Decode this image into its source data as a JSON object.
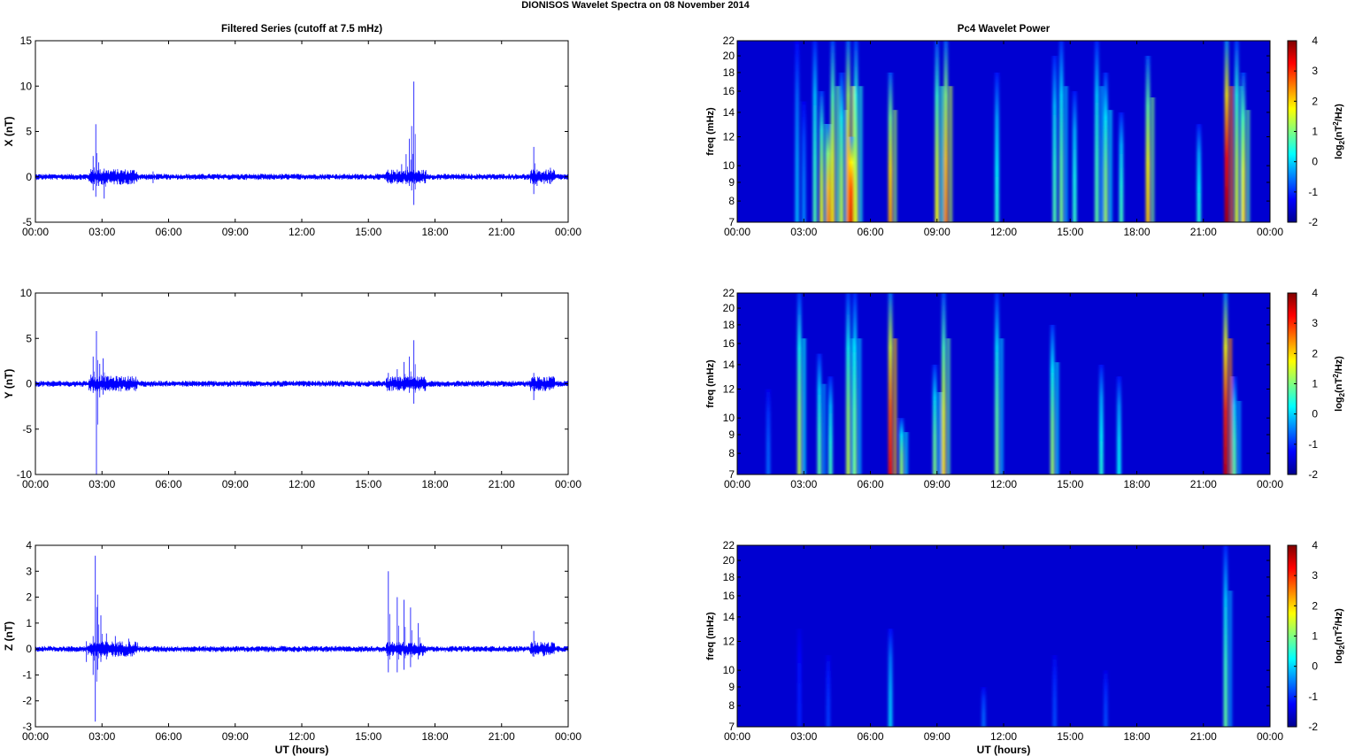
{
  "figure": {
    "title": "DIONISOS Wavelet Spectra on 08 November  2014"
  },
  "colors": {
    "trace": "#0000ff",
    "axis": "#000000"
  },
  "colormap": "jet",
  "chart_data": [
    {
      "type": "line",
      "panel": "X",
      "title": "Filtered Series (cutoff at 7.5 mHz)",
      "xlabel": "",
      "ylabel": "X (nT)",
      "xlim": [
        0,
        24
      ],
      "ylim": [
        -5,
        15
      ],
      "xticks": [
        "00:00",
        "03:00",
        "06:00",
        "09:00",
        "12:00",
        "15:00",
        "18:00",
        "21:00",
        "00:00"
      ],
      "yticks": [
        -5,
        0,
        5,
        10,
        15
      ],
      "series": [
        {
          "x_hours": [
            0,
            24
          ],
          "baseline": 0
        }
      ],
      "bursts": [
        {
          "t": 2.6,
          "max": 2.3,
          "min": -1.5
        },
        {
          "t": 2.72,
          "max": 5.8,
          "min": -2.2
        },
        {
          "t": 2.85,
          "max": 1.6,
          "min": -1.0
        },
        {
          "t": 3.1,
          "max": 0.9,
          "min": -2.4
        },
        {
          "t": 3.4,
          "max": 0.6,
          "min": -0.6
        },
        {
          "t": 5.3,
          "max": 0.6,
          "min": -0.7
        },
        {
          "t": 16.3,
          "max": 0.8,
          "min": -0.5
        },
        {
          "t": 16.5,
          "max": 1.4,
          "min": -0.6
        },
        {
          "t": 16.7,
          "max": 2.5,
          "min": -0.8
        },
        {
          "t": 16.85,
          "max": 4.2,
          "min": -1.0
        },
        {
          "t": 16.95,
          "max": 5.6,
          "min": -1.5
        },
        {
          "t": 17.05,
          "max": 10.5,
          "min": -3.1
        },
        {
          "t": 22.45,
          "max": 3.3,
          "min": -1.9
        },
        {
          "t": 22.6,
          "max": 0.8,
          "min": -1.0
        },
        {
          "t": 23.2,
          "max": 1.0,
          "min": -0.8
        }
      ]
    },
    {
      "type": "line",
      "panel": "Y",
      "title": "",
      "xlabel": "",
      "ylabel": "Y (nT)",
      "xlim": [
        0,
        24
      ],
      "ylim": [
        -10,
        10
      ],
      "xticks": [
        "00:00",
        "03:00",
        "06:00",
        "09:00",
        "12:00",
        "15:00",
        "18:00",
        "21:00",
        "00:00"
      ],
      "yticks": [
        -10,
        -5,
        0,
        5,
        10
      ],
      "series": [
        {
          "x_hours": [
            0,
            24
          ],
          "baseline": 0
        }
      ],
      "bursts": [
        {
          "t": 2.5,
          "max": 1.0,
          "min": -0.6
        },
        {
          "t": 2.6,
          "max": 3.0,
          "min": -1.0
        },
        {
          "t": 2.75,
          "max": 5.8,
          "min": -10.0
        },
        {
          "t": 2.9,
          "max": 2.2,
          "min": -1.5
        },
        {
          "t": 3.05,
          "max": 2.8,
          "min": -1.2
        },
        {
          "t": 3.3,
          "max": 0.8,
          "min": -0.6
        },
        {
          "t": 15.9,
          "max": 1.2,
          "min": -0.4
        },
        {
          "t": 16.3,
          "max": 1.6,
          "min": -0.6
        },
        {
          "t": 16.6,
          "max": 2.4,
          "min": -0.8
        },
        {
          "t": 16.85,
          "max": 3.0,
          "min": -1.0
        },
        {
          "t": 17.05,
          "max": 4.8,
          "min": -2.2
        },
        {
          "t": 22.45,
          "max": 1.2,
          "min": -1.8
        }
      ]
    },
    {
      "type": "line",
      "panel": "Z",
      "title": "",
      "xlabel": "UT (hours)",
      "ylabel": "Z (nT)",
      "xlim": [
        0,
        24
      ],
      "ylim": [
        -3,
        4
      ],
      "xticks": [
        "00:00",
        "03:00",
        "06:00",
        "09:00",
        "12:00",
        "15:00",
        "18:00",
        "21:00",
        "00:00"
      ],
      "yticks": [
        -3,
        -2,
        -1,
        0,
        1,
        2,
        3,
        4
      ],
      "series": [
        {
          "x_hours": [
            0,
            24
          ],
          "baseline": 0
        }
      ],
      "bursts": [
        {
          "t": 2.3,
          "max": 0.3,
          "min": -0.5
        },
        {
          "t": 2.6,
          "max": 0.5,
          "min": -1.0
        },
        {
          "t": 2.7,
          "max": 3.6,
          "min": -2.8
        },
        {
          "t": 2.8,
          "max": 2.1,
          "min": -0.8
        },
        {
          "t": 2.95,
          "max": 1.3,
          "min": -0.5
        },
        {
          "t": 3.2,
          "max": 0.6,
          "min": -0.4
        },
        {
          "t": 3.6,
          "max": 0.5,
          "min": -0.3
        },
        {
          "t": 4.2,
          "max": 0.4,
          "min": -0.2
        },
        {
          "t": 15.9,
          "max": 3.0,
          "min": -0.9
        },
        {
          "t": 16.3,
          "max": 2.0,
          "min": -0.9
        },
        {
          "t": 16.6,
          "max": 1.9,
          "min": -0.8
        },
        {
          "t": 16.9,
          "max": 1.6,
          "min": -0.7
        },
        {
          "t": 17.25,
          "max": 1.0,
          "min": -0.4
        },
        {
          "t": 22.45,
          "max": 0.7,
          "min": -0.3
        }
      ]
    },
    {
      "type": "heatmap",
      "panel": "X",
      "title": "Pc4 Wavelet Power",
      "xlabel": "",
      "ylabel": "freq (mHz)",
      "xlim": [
        0,
        24
      ],
      "ylim": [
        7,
        22
      ],
      "log_y": true,
      "xticks": [
        "00:00",
        "03:00",
        "06:00",
        "09:00",
        "12:00",
        "15:00",
        "18:00",
        "21:00",
        "00:00"
      ],
      "yticks": [
        7,
        8,
        9,
        10,
        12,
        14,
        16,
        18,
        20,
        22
      ],
      "colorbar": {
        "label": "log₂(nT²/Hz)",
        "label_base": "log",
        "label_sub": "2",
        "label_unit": "(nT",
        "label_sup": "2",
        "label_tail": "/Hz)",
        "min": -2,
        "max": 4,
        "ticks": [
          -2,
          -1,
          0,
          1,
          2,
          3,
          4
        ]
      },
      "background": -2,
      "streaks": [
        {
          "t": 2.7,
          "peak": -0.5,
          "topF": 22
        },
        {
          "t": 3.0,
          "peak": -0.8,
          "topF": 15
        },
        {
          "t": 3.5,
          "peak": 0.5,
          "topF": 22
        },
        {
          "t": 3.8,
          "peak": 1.5,
          "topF": 16
        },
        {
          "t": 4.1,
          "peak": 2.5,
          "topF": 13
        },
        {
          "t": 4.3,
          "peak": 1.8,
          "topF": 22
        },
        {
          "t": 4.7,
          "peak": 1.2,
          "topF": 18
        },
        {
          "t": 5.0,
          "peak": 2.6,
          "topF": 22
        },
        {
          "t": 5.15,
          "peak": 3.6,
          "topF": 12
        },
        {
          "t": 5.35,
          "peak": 1.4,
          "topF": 22
        },
        {
          "t": 6.9,
          "peak": 2.2,
          "topF": 18
        },
        {
          "t": 9.0,
          "peak": 1.6,
          "topF": 22
        },
        {
          "t": 9.4,
          "peak": 2.4,
          "topF": 22
        },
        {
          "t": 11.7,
          "peak": 0.2,
          "topF": 18
        },
        {
          "t": 14.3,
          "peak": 0.5,
          "topF": 20
        },
        {
          "t": 14.6,
          "peak": 0.8,
          "topF": 22
        },
        {
          "t": 15.2,
          "peak": 0.3,
          "topF": 16
        },
        {
          "t": 16.2,
          "peak": 0.6,
          "topF": 22
        },
        {
          "t": 16.6,
          "peak": 1.0,
          "topF": 18
        },
        {
          "t": 17.3,
          "peak": 0.4,
          "topF": 14
        },
        {
          "t": 18.5,
          "peak": 2.0,
          "topF": 20
        },
        {
          "t": 20.8,
          "peak": 0.2,
          "topF": 13
        },
        {
          "t": 22.05,
          "peak": 3.8,
          "topF": 22
        },
        {
          "t": 22.5,
          "peak": 1.4,
          "topF": 22
        },
        {
          "t": 22.8,
          "peak": 1.8,
          "topF": 18
        }
      ]
    },
    {
      "type": "heatmap",
      "panel": "Y",
      "title": "",
      "xlabel": "",
      "ylabel": "freq (mHz)",
      "xlim": [
        0,
        24
      ],
      "ylim": [
        7,
        22
      ],
      "log_y": true,
      "xticks": [
        "00:00",
        "03:00",
        "06:00",
        "09:00",
        "12:00",
        "15:00",
        "18:00",
        "21:00",
        "00:00"
      ],
      "yticks": [
        7,
        8,
        9,
        10,
        12,
        14,
        16,
        18,
        20,
        22
      ],
      "colorbar": {
        "label": "log₂(nT²/Hz)",
        "label_base": "log",
        "label_sub": "2",
        "label_unit": "(nT",
        "label_sup": "2",
        "label_tail": "/Hz)",
        "min": -2,
        "max": 4,
        "ticks": [
          -2,
          -1,
          0,
          1,
          2,
          3,
          4
        ]
      },
      "background": -2,
      "streaks": [
        {
          "t": 1.4,
          "peak": -1.0,
          "topF": 12
        },
        {
          "t": 2.8,
          "peak": 1.2,
          "topF": 22
        },
        {
          "t": 3.7,
          "peak": 0.6,
          "topF": 15
        },
        {
          "t": 4.2,
          "peak": 0.4,
          "topF": 13
        },
        {
          "t": 5.0,
          "peak": 1.2,
          "topF": 22
        },
        {
          "t": 5.3,
          "peak": 0.8,
          "topF": 22
        },
        {
          "t": 6.9,
          "peak": 3.2,
          "topF": 22
        },
        {
          "t": 7.4,
          "peak": 1.0,
          "topF": 10
        },
        {
          "t": 8.9,
          "peak": 0.8,
          "topF": 14
        },
        {
          "t": 9.3,
          "peak": 1.8,
          "topF": 22
        },
        {
          "t": 11.7,
          "peak": 0.8,
          "topF": 22
        },
        {
          "t": 14.2,
          "peak": 1.0,
          "topF": 18
        },
        {
          "t": 16.4,
          "peak": 0.2,
          "topF": 14
        },
        {
          "t": 17.2,
          "peak": 0.0,
          "topF": 13
        },
        {
          "t": 22.0,
          "peak": 3.6,
          "topF": 22
        },
        {
          "t": 22.4,
          "peak": 0.6,
          "topF": 13
        }
      ]
    },
    {
      "type": "heatmap",
      "panel": "Z",
      "title": "",
      "xlabel": "UT (hours)",
      "ylabel": "freq (mHz)",
      "xlim": [
        0,
        24
      ],
      "ylim": [
        7,
        22
      ],
      "log_y": true,
      "xticks": [
        "00:00",
        "03:00",
        "06:00",
        "09:00",
        "12:00",
        "15:00",
        "18:00",
        "21:00",
        "00:00"
      ],
      "yticks": [
        7,
        8,
        9,
        10,
        12,
        14,
        16,
        18,
        20,
        22
      ],
      "colorbar": {
        "label": "log₂(nT²/Hz)",
        "label_base": "log",
        "label_sub": "2",
        "label_unit": "(nT",
        "label_sup": "2",
        "label_tail": "/Hz)",
        "min": -2,
        "max": 4,
        "ticks": [
          -2,
          -1,
          0,
          1,
          2,
          3,
          4
        ]
      },
      "background": -2,
      "streaks": [
        {
          "t": 2.8,
          "peak": -1.5,
          "topF": 13
        },
        {
          "t": 4.1,
          "peak": -1.3,
          "topF": 11
        },
        {
          "t": 6.9,
          "peak": -0.3,
          "topF": 13
        },
        {
          "t": 11.1,
          "peak": -1.0,
          "topF": 9
        },
        {
          "t": 14.3,
          "peak": -1.2,
          "topF": 11
        },
        {
          "t": 16.6,
          "peak": -1.2,
          "topF": 10
        },
        {
          "t": 22.0,
          "peak": 0.6,
          "topF": 22
        }
      ]
    }
  ]
}
